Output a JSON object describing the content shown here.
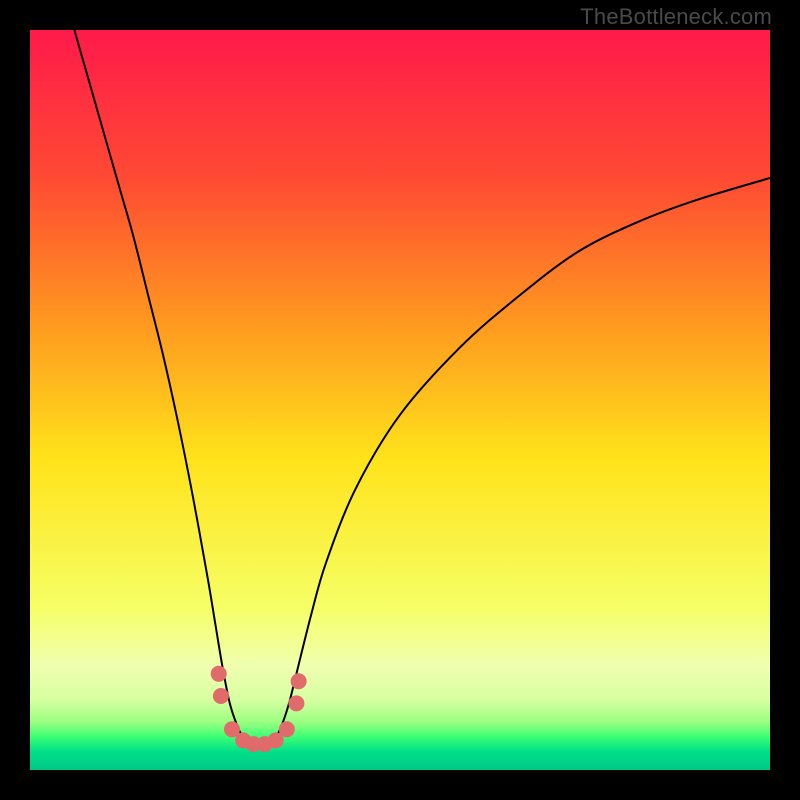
{
  "watermark": "TheBottleneck.com",
  "chart_data": {
    "type": "line",
    "title": "",
    "xlabel": "",
    "ylabel": "",
    "xlim": [
      0,
      100
    ],
    "ylim": [
      0,
      100
    ],
    "background_gradient_stops": [
      {
        "offset": 0.0,
        "color": "#ff1a4a"
      },
      {
        "offset": 0.2,
        "color": "#ff4a33"
      },
      {
        "offset": 0.4,
        "color": "#ff9a1f"
      },
      {
        "offset": 0.58,
        "color": "#ffe31a"
      },
      {
        "offset": 0.78,
        "color": "#f6ff66"
      },
      {
        "offset": 0.86,
        "color": "#f0ffb0"
      },
      {
        "offset": 0.905,
        "color": "#d6ffa0"
      },
      {
        "offset": 0.935,
        "color": "#9cff82"
      },
      {
        "offset": 0.955,
        "color": "#3cff74"
      },
      {
        "offset": 0.975,
        "color": "#00e089"
      },
      {
        "offset": 1.0,
        "color": "#00c888"
      }
    ],
    "series": [
      {
        "name": "bottleneck-curve",
        "color": "#000000",
        "x": [
          6,
          8,
          10,
          12,
          14,
          16,
          18,
          20,
          22,
          24,
          25,
          26,
          27,
          28,
          29,
          30,
          31,
          32,
          33,
          34,
          35,
          36,
          38,
          40,
          44,
          50,
          58,
          66,
          74,
          82,
          90,
          100
        ],
        "y": [
          100,
          93,
          86,
          79,
          72,
          64,
          56,
          47,
          37,
          26,
          20,
          14,
          9,
          6,
          4,
          3,
          3,
          3,
          4,
          6,
          9,
          13,
          21,
          28,
          38,
          48,
          57,
          64,
          70,
          74,
          77,
          80
        ]
      }
    ],
    "markers": {
      "name": "highlight-dots",
      "color": "#e16a6a",
      "radius_px": 8,
      "points_xy": [
        [
          25.5,
          13
        ],
        [
          25.8,
          10
        ],
        [
          27.3,
          5.5
        ],
        [
          28.8,
          4
        ],
        [
          30.2,
          3.5
        ],
        [
          31.7,
          3.5
        ],
        [
          33.2,
          4
        ],
        [
          34.7,
          5.5
        ],
        [
          36.0,
          9
        ],
        [
          36.3,
          12
        ]
      ]
    }
  }
}
